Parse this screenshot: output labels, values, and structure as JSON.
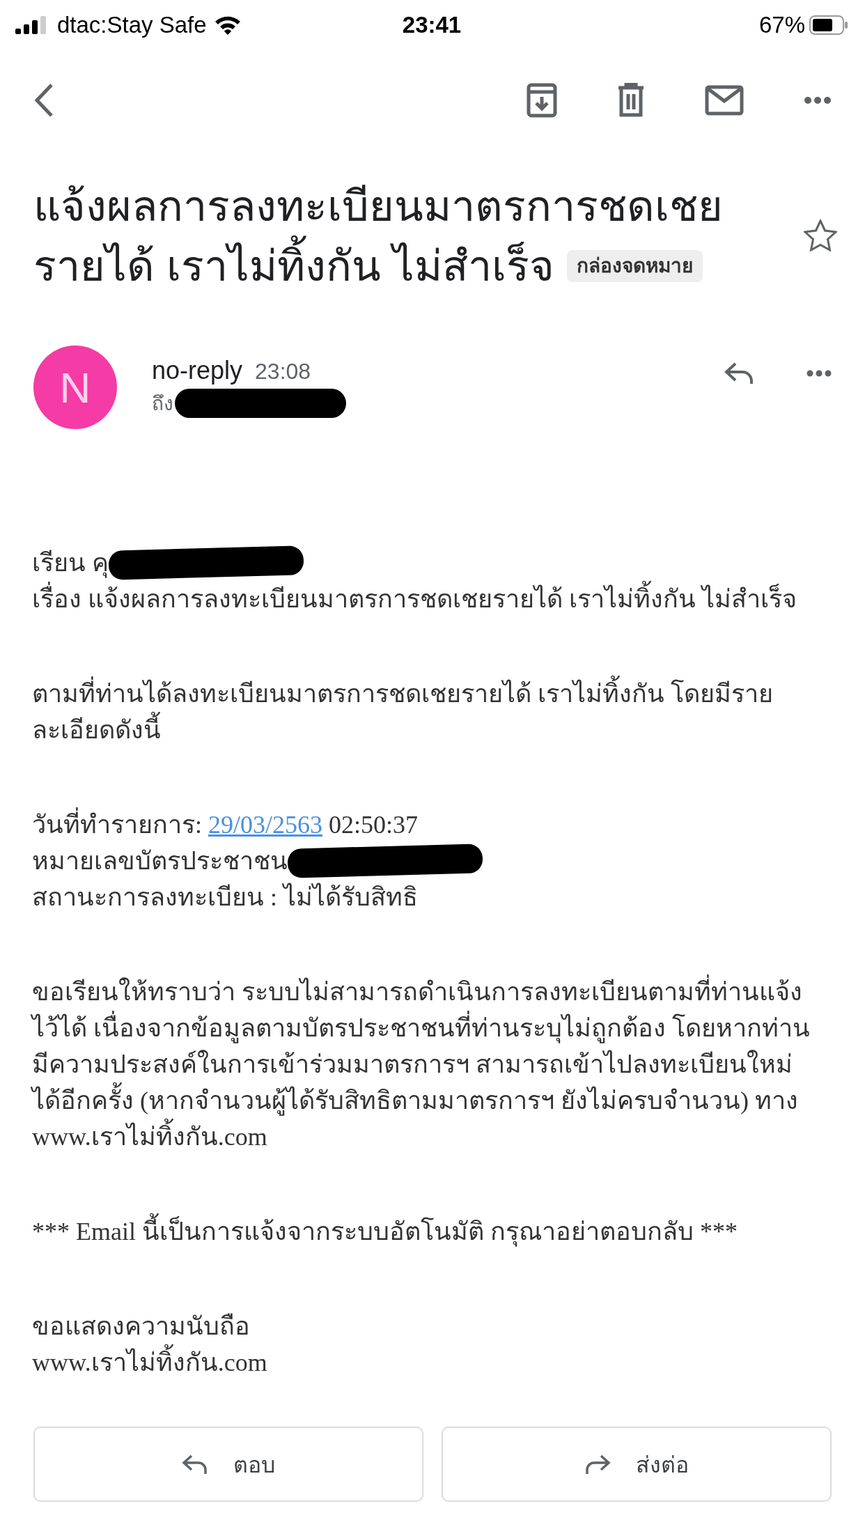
{
  "status_bar": {
    "carrier": "dtac:Stay Safe",
    "time": "23:41",
    "battery": "67%"
  },
  "subject": {
    "title": "แจ้งผลการลงทะเบียนมาตรการชดเชย\nรายได้ เราไม่ทิ้งกัน ไม่สำเร็จ",
    "label": "กล่องจดหมาย",
    "starred": false
  },
  "sender": {
    "avatar_letter": "N",
    "name": "no-reply",
    "time": "23:08",
    "to_label": "ถึง"
  },
  "body": [
    [
      {
        "kind": "redacted",
        "text": "เรียน คุ"
      },
      {
        "kind": "text",
        "text": "เรื่อง แจ้งผลการลงทะเบียนมาตรการชดเชยรายได้ เราไม่ทิ้งกัน ไม่สำเร็จ"
      }
    ],
    [
      {
        "kind": "text",
        "text": "ตามที่ท่านได้ลงทะเบียนมาตรการชดเชยรายได้ เราไม่ทิ้งกัน โดยมีราย\nละเอียดดังนี้"
      }
    ],
    [
      {
        "kind": "date",
        "text": "วันที่ทำรายการ:",
        "link": "29/03/2563",
        "time": "02:50:37"
      },
      {
        "kind": "redacted",
        "text": "หมายเลขบัตรประชาชน"
      },
      {
        "kind": "text",
        "text": "สถานะการลงทะเบียน : ไม่ได้รับสิทธิ"
      }
    ],
    [
      {
        "kind": "text",
        "text": "ขอเรียนให้ทราบว่า ระบบไม่สามารถดำเนินการลงทะเบียนตามที่ท่านแจ้ง\nไว้ได้ เนื่องจากข้อมูลตามบัตรประชาชนที่ท่านระบุไม่ถูกต้อง โดยหากท่าน\nมีความประสงค์ในการเข้าร่วมมาตรการฯ สามารถเข้าไปลงทะเบียนใหม่\nได้อีกครั้ง (หากจำนวนผู้ได้รับสิทธิตามมาตรการฯ ยังไม่ครบจำนวน) ทาง\nwww.เราไม่ทิ้งกัน.com"
      }
    ],
    [
      {
        "kind": "text",
        "text": "*** Email นี้เป็นการแจ้งจากระบบอัตโนมัติ กรุณาอย่าตอบกลับ ***"
      }
    ],
    [
      {
        "kind": "text",
        "text": "ขอแสดงความนับถือ\nwww.เราไม่ทิ้งกัน.com"
      }
    ]
  ],
  "actions": [
    {
      "kind": "reply",
      "label": "ตอบ"
    },
    {
      "kind": "forward",
      "label": "ส่งต่อ"
    }
  ]
}
